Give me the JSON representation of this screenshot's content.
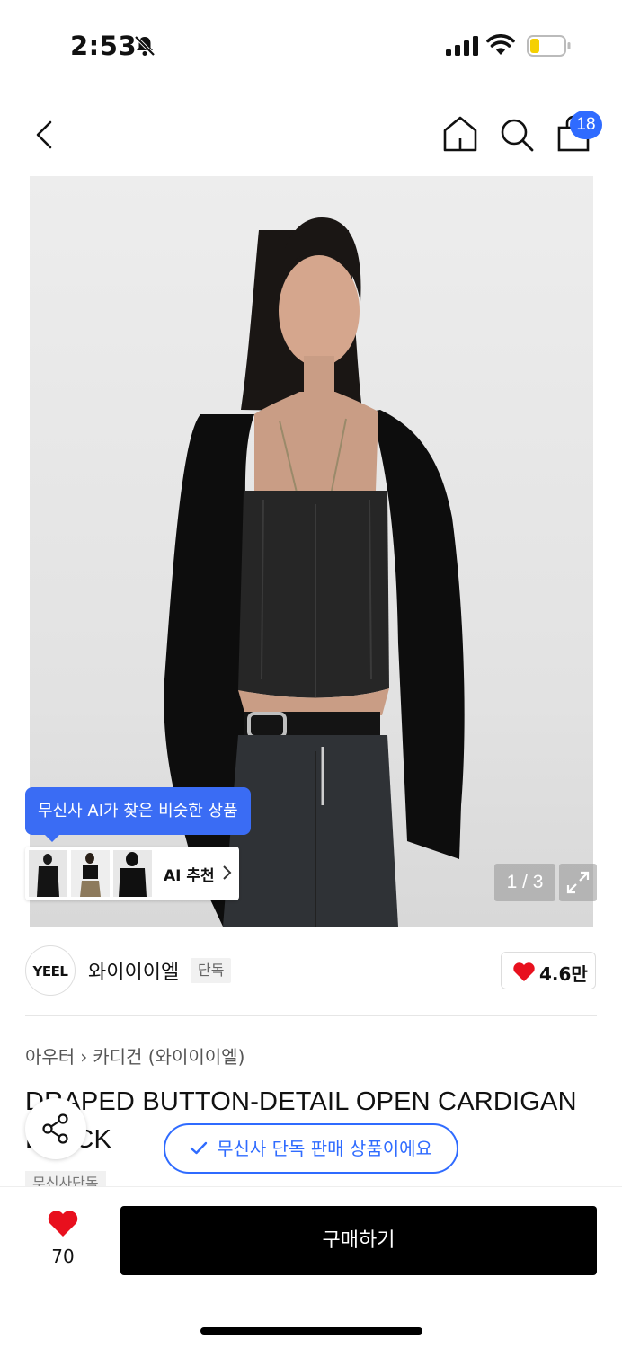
{
  "status": {
    "time": "2:53",
    "icons": [
      "bell-off-icon",
      "signal-icon",
      "wifi-icon",
      "battery-icon"
    ],
    "battery_color": "#f5d000"
  },
  "nav": {
    "icons": [
      "back-icon",
      "home-icon",
      "search-icon",
      "cart-icon"
    ],
    "cart_badge": "18"
  },
  "gallery": {
    "ai_tooltip": "무신사 AI가 찾은 비슷한 상품",
    "ai_label": "AI 추천",
    "pager": "1 / 3"
  },
  "brand": {
    "logo_text": "YEEL",
    "name": "와이이이엘",
    "badge": "단독",
    "likes": "4.6만"
  },
  "product": {
    "breadcrumb": [
      "아우터",
      "카디건 (와이이이엘)"
    ],
    "title": "DRAPED BUTTON-DETAIL OPEN CARDIGAN BLACK",
    "tag": "무신사단독",
    "exclusive_notice": "무신사 단독 판매 상품이에요"
  },
  "footer": {
    "wish_count": "70",
    "buy_label": "구매하기"
  },
  "colors": {
    "accent": "#2f6bff",
    "heart": "#e8101e",
    "buy_bg": "#000000"
  }
}
